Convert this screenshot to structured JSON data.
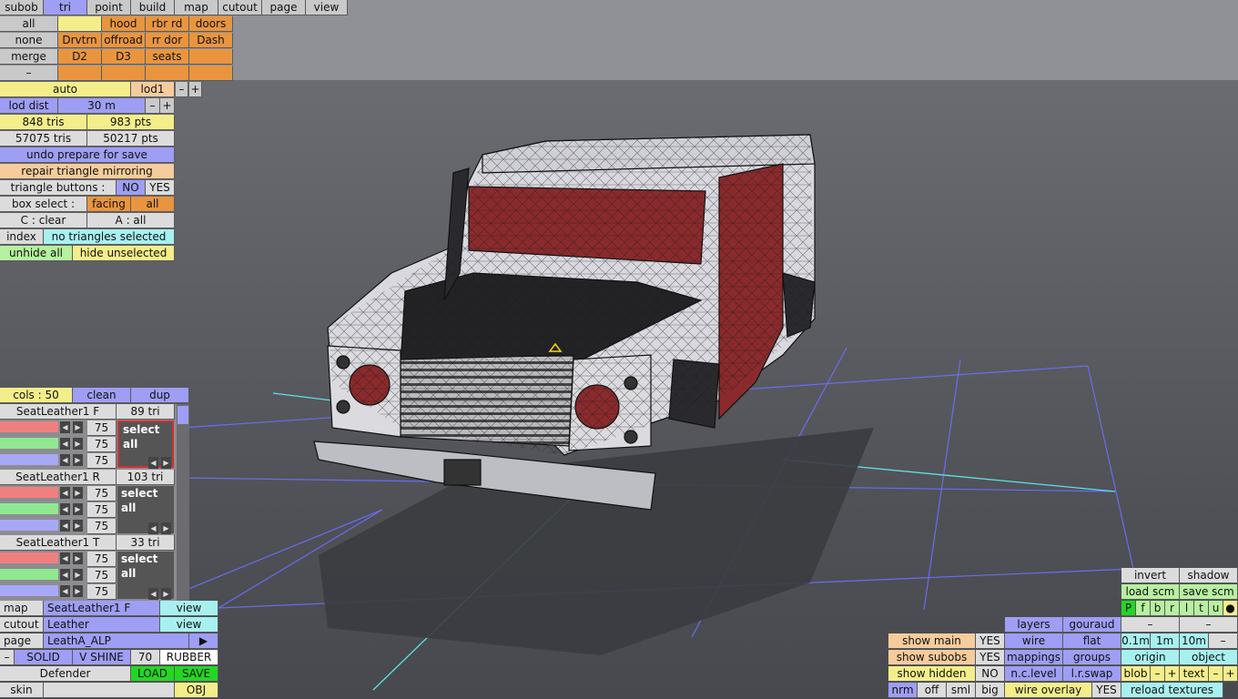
{
  "top_tabs": [
    "subob",
    "tri",
    "point",
    "build",
    "map",
    "cutout",
    "page",
    "view"
  ],
  "subob_grid": [
    [
      "all",
      "",
      "hood",
      "rbr rd",
      "doors"
    ],
    [
      "none",
      "Drvtrn",
      "offroad",
      "rr dor",
      "Dash"
    ],
    [
      "merge",
      "D2",
      "D3",
      "seats",
      ""
    ],
    [
      "–",
      "",
      "",
      "",
      ""
    ]
  ],
  "left_panel": {
    "auto": "auto",
    "lod": "lod1",
    "lod_minus": "–",
    "lod_plus": "+",
    "lod_dist_label": "lod dist",
    "lod_dist_value": "30 m",
    "dist_minus": "–",
    "dist_plus": "+",
    "tris_a": "848 tris",
    "pts_a": "983 pts",
    "tris_b": "57075 tris",
    "pts_b": "50217 pts",
    "undo": "undo prepare for save",
    "repair": "repair triangle mirroring",
    "tri_buttons_label": "triangle buttons :",
    "no": "NO",
    "yes": "YES",
    "box_select_label": "box select :",
    "facing": "facing",
    "box_all": "all",
    "c_clear": "C : clear",
    "a_all": "A : all",
    "index": "index",
    "no_tri_selected": "no triangles selected",
    "unhide_all": "unhide all",
    "hide_unselected": "hide unselected"
  },
  "colors_panel": {
    "cols": "cols : 50",
    "clean": "clean",
    "dup": "dup",
    "entries": [
      {
        "name": "SeatLeather1 F",
        "tris": "89 tri",
        "values": [
          "75",
          "75",
          "75"
        ],
        "select": "select all"
      },
      {
        "name": "SeatLeather1 R",
        "tris": "103 tri",
        "values": [
          "75",
          "75",
          "75"
        ],
        "select": "select all"
      },
      {
        "name": "SeatLeather1 T",
        "tris": "33 tri",
        "values": [
          "75",
          "75",
          "75"
        ],
        "select": "select all"
      }
    ]
  },
  "bottom_left": {
    "map_label": "map",
    "map_value": "SeatLeather1 F",
    "map_view": "view",
    "cutout_label": "cutout",
    "cutout_value": "Leather",
    "cutout_view": "view",
    "page_label": "page",
    "page_value": "LeathA_ALP",
    "page_arrow": "▶",
    "minus": "–",
    "solid": "SOLID",
    "vshine": "V SHINE",
    "num": "70",
    "rubber": "RUBBER",
    "model": "Defender",
    "load": "LOAD",
    "save": "SAVE",
    "skin": "skin",
    "obj": "OBJ"
  },
  "right_panel": {
    "invert": "invert",
    "shadow": "shadow",
    "load_scm": "load scm",
    "save_scm": "save scm",
    "letters": [
      "P",
      "f",
      "b",
      "r",
      "l",
      "t",
      "u",
      "●"
    ],
    "layers": "layers",
    "gouraud": "gouraud",
    "dash1": "–",
    "dash2": "–",
    "show_main": "show main",
    "show_main_val": "YES",
    "wire": "wire",
    "flat": "flat",
    "d01": "0.1m",
    "d1": "1m",
    "d10": "10m",
    "dminus": "–",
    "show_subobs": "show subobs",
    "show_subobs_val": "YES",
    "mappings": "mappings",
    "groups": "groups",
    "origin": "origin",
    "object": "object",
    "show_hidden": "show hidden",
    "show_hidden_val": "NO",
    "nc_level": "n.c.level",
    "lr_swap": "l.r.swap",
    "blob": "blob",
    "blob_minus": "–",
    "blob_plus": "+",
    "text": "text",
    "text_minus": "–",
    "text_plus": "+",
    "nrm": "nrm",
    "off": "off",
    "sml": "sml",
    "big": "big",
    "wire_overlay": "wire overlay",
    "wire_overlay_val": "YES",
    "reload": "reload textures"
  },
  "colors": {
    "accent_blue": "#9e9ef4",
    "accent_orange": "#e9953f",
    "grid_blue": "#6a6cf0",
    "grid_cyan": "#5fe0e8",
    "body_red": "#8a2a2c"
  }
}
